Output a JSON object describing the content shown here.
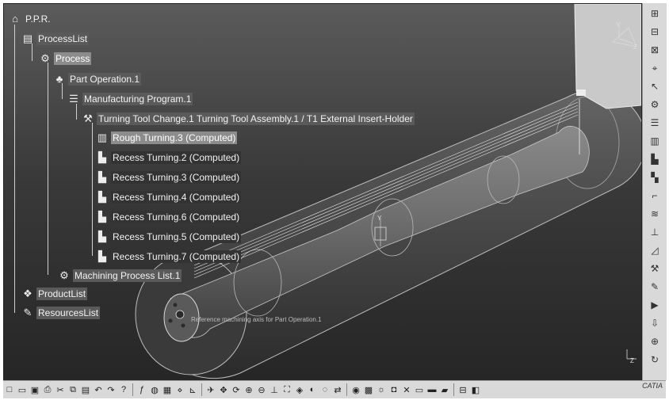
{
  "tree": {
    "root": "P.P.R.",
    "process_list": "ProcessList",
    "process": "Process",
    "part_operation": "Part Operation.1",
    "manufacturing_program": "Manufacturing Program.1",
    "tool_change": "Turning Tool Change.1  Turning Tool Assembly.1 / T1 External Insert-Holder",
    "operations": [
      "Rough Turning.3 (Computed)",
      "Recess Turning.2 (Computed)",
      "Recess Turning.3 (Computed)",
      "Recess Turning.4 (Computed)",
      "Recess Turning.6 (Computed)",
      "Recess Turning.5 (Computed)",
      "Recess Turning.7 (Computed)"
    ],
    "machining_process_list": "Machining Process List.1",
    "product_list": "ProductList",
    "resources_list": "ResourcesList"
  },
  "viewport": {
    "axis_note": "Reference machining axis for Part Operation.1",
    "compass_axes": [
      "Y",
      "Z"
    ],
    "part_axis": "Y",
    "corner_axis": "Z"
  },
  "logo": "CATIA",
  "right_toolbar_icons": [
    "measure-icon",
    "sketch-icon",
    "sketch-icon",
    "analysis-icon",
    "select-icon",
    "operation-icon",
    "list-icon",
    "rough-icon",
    "recess-icon",
    "groove-icon",
    "profile-icon",
    "thread-icon",
    "drill-icon",
    "ramp-icon",
    "machine-icon",
    "tool-icon",
    "simulate-icon",
    "output-icon",
    "nc-icon",
    "cycle-icon"
  ],
  "bottom_toolbar_icons": [
    "new-icon",
    "open-icon",
    "save-icon",
    "print-icon",
    "cut-icon",
    "copy-icon",
    "paste-icon",
    "undo-icon",
    "redo-icon",
    "help-icon",
    "formula-icon",
    "catalog-icon",
    "grid-icon",
    "snap-icon",
    "measure-icon",
    "fly-icon",
    "pan-icon",
    "rotate-icon",
    "zoom-in-icon",
    "zoom-out-icon",
    "normal-view-icon",
    "fit-icon",
    "iso-view-icon",
    "shading-icon",
    "hide-icon",
    "swap-icon",
    "render-icon",
    "material-icon",
    "light-icon",
    "capture-icon",
    "tools-icon",
    "display-icon",
    "mode-icon",
    "layer-icon",
    "filter-icon",
    "properties-icon"
  ]
}
